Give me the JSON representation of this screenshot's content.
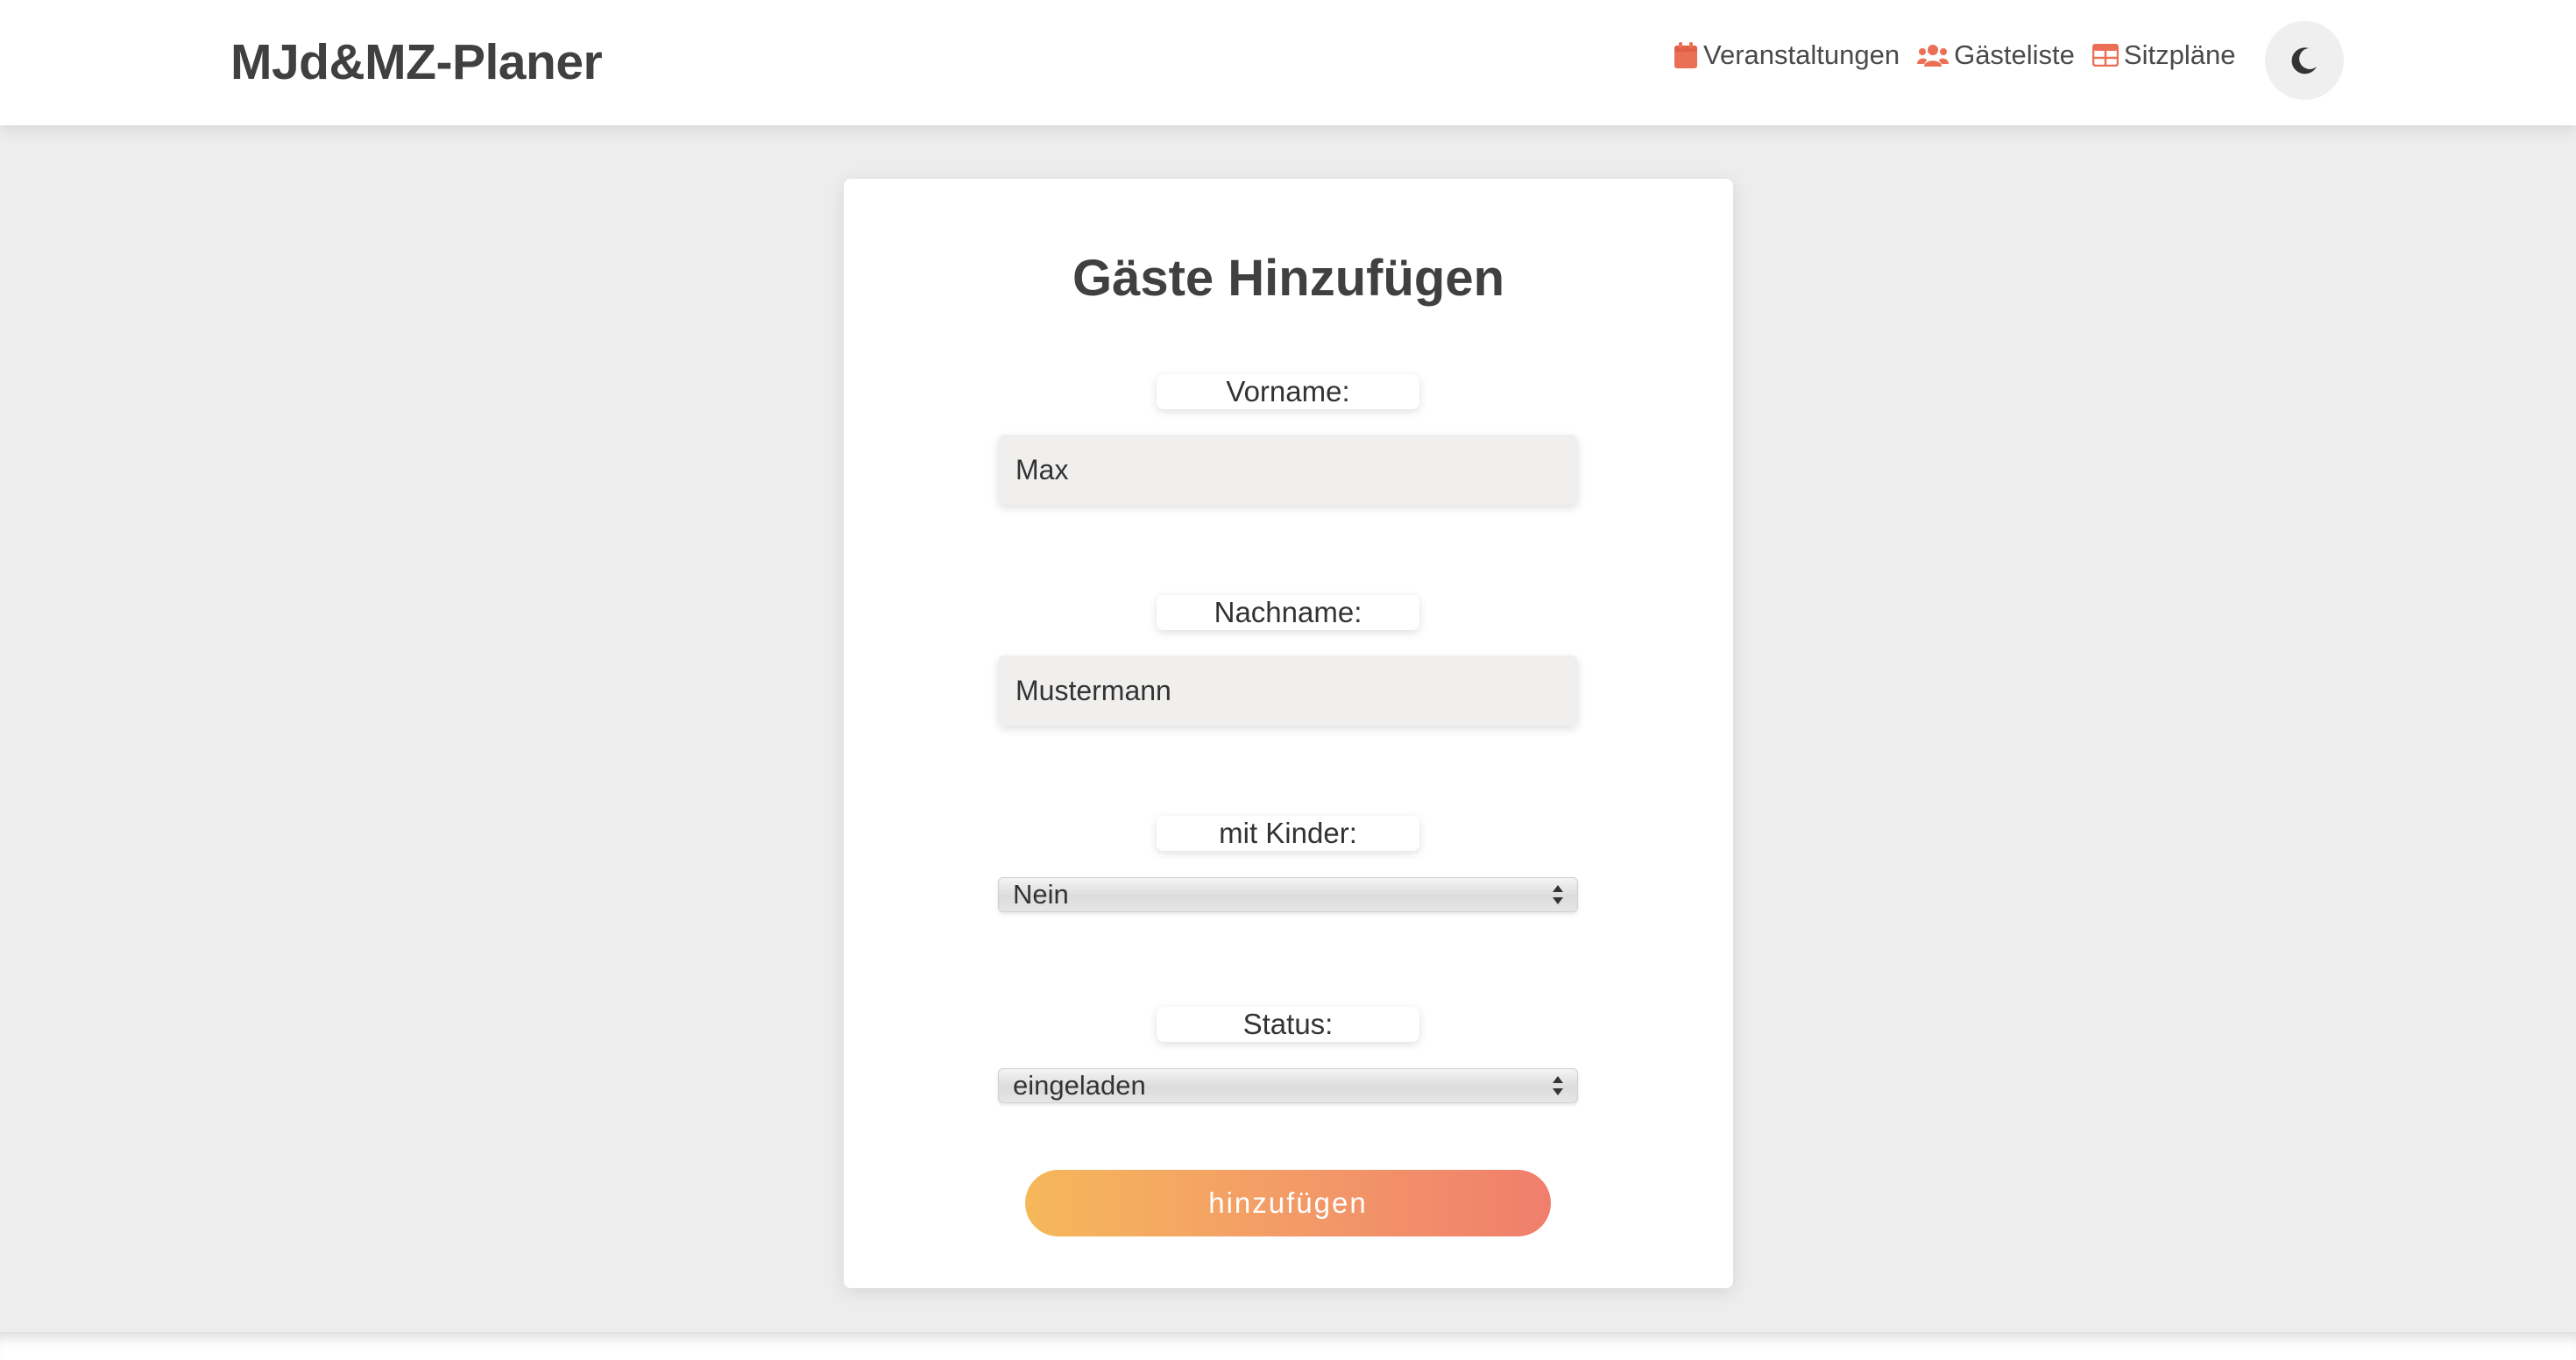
{
  "app": {
    "brand": "MJd&MZ-Planer"
  },
  "nav": {
    "items": [
      {
        "label": "Veranstaltungen",
        "icon": "calendar-icon"
      },
      {
        "label": "Gästeliste",
        "icon": "users-icon"
      },
      {
        "label": "Sitzpläne",
        "icon": "table-icon"
      }
    ],
    "theme_toggle_icon": "moon-icon"
  },
  "form": {
    "title": "Gäste Hinzufügen",
    "first_name_label": "Vorname:",
    "first_name_value": "Max",
    "last_name_label": "Nachname:",
    "last_name_value": "Mustermann",
    "children_label": "mit Kinder:",
    "children_value": "Nein",
    "status_label": "Status:",
    "status_value": "eingeladen",
    "submit_label": "hinzufügen"
  },
  "colors": {
    "accent": "#f0745c",
    "button_gradient_start": "#f5b85a",
    "button_gradient_end": "#f07e6c",
    "background": "#ededed"
  }
}
